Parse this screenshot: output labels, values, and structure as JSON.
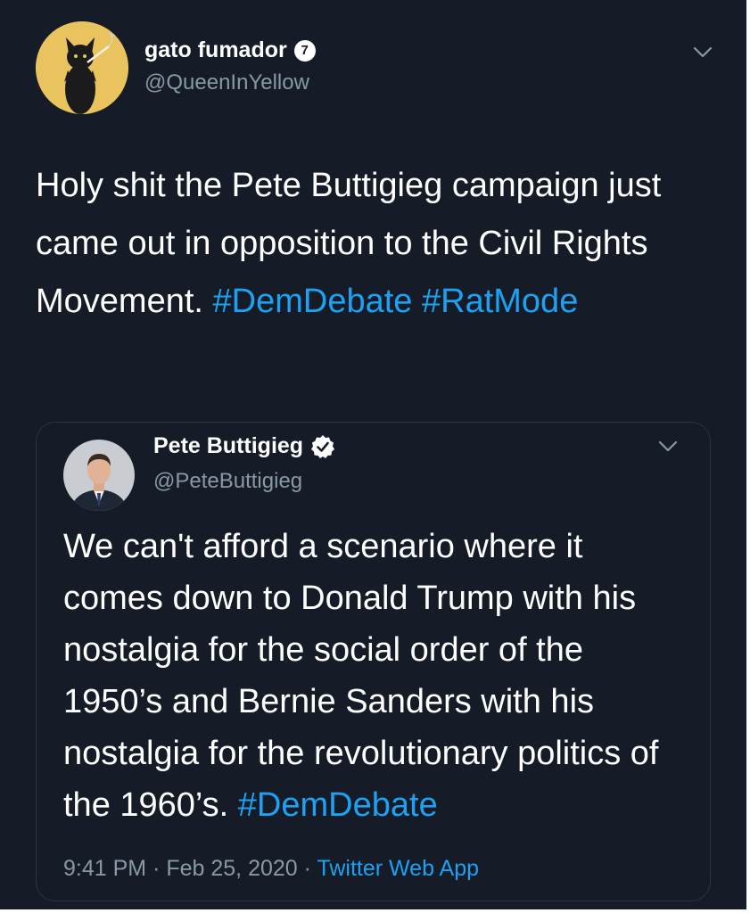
{
  "tweet": {
    "author": {
      "display_name": "gato fumador",
      "badge": "7",
      "handle": "@QueenInYellow",
      "avatar_icon": "cat-avatar-icon"
    },
    "text": "Holy shit the Pete Buttigieg campaign just came out in opposition to the Civil Rights Movement.",
    "hashtags": [
      "#DemDebate",
      "#RatMode"
    ]
  },
  "quoted_tweet": {
    "author": {
      "display_name": "Pete Buttigieg",
      "handle": "@PeteButtigieg",
      "verified_icon": "verified-badge-icon",
      "avatar_icon": "person-avatar-icon"
    },
    "text": "We can't afford a scenario where it comes down to Donald Trump with his nostalgia for the social order of the 1950’s and Bernie Sanders with his nostalgia for the revolutionary politics of the 1960’s.",
    "hashtag": "#DemDebate",
    "time": "9:41 PM",
    "separator": "·",
    "date": "Feb 25, 2020",
    "source": "Twitter Web App"
  },
  "colors": {
    "background": "#151c27",
    "link": "#1da1f2",
    "muted": "#8899a6",
    "text": "#ffffff"
  }
}
